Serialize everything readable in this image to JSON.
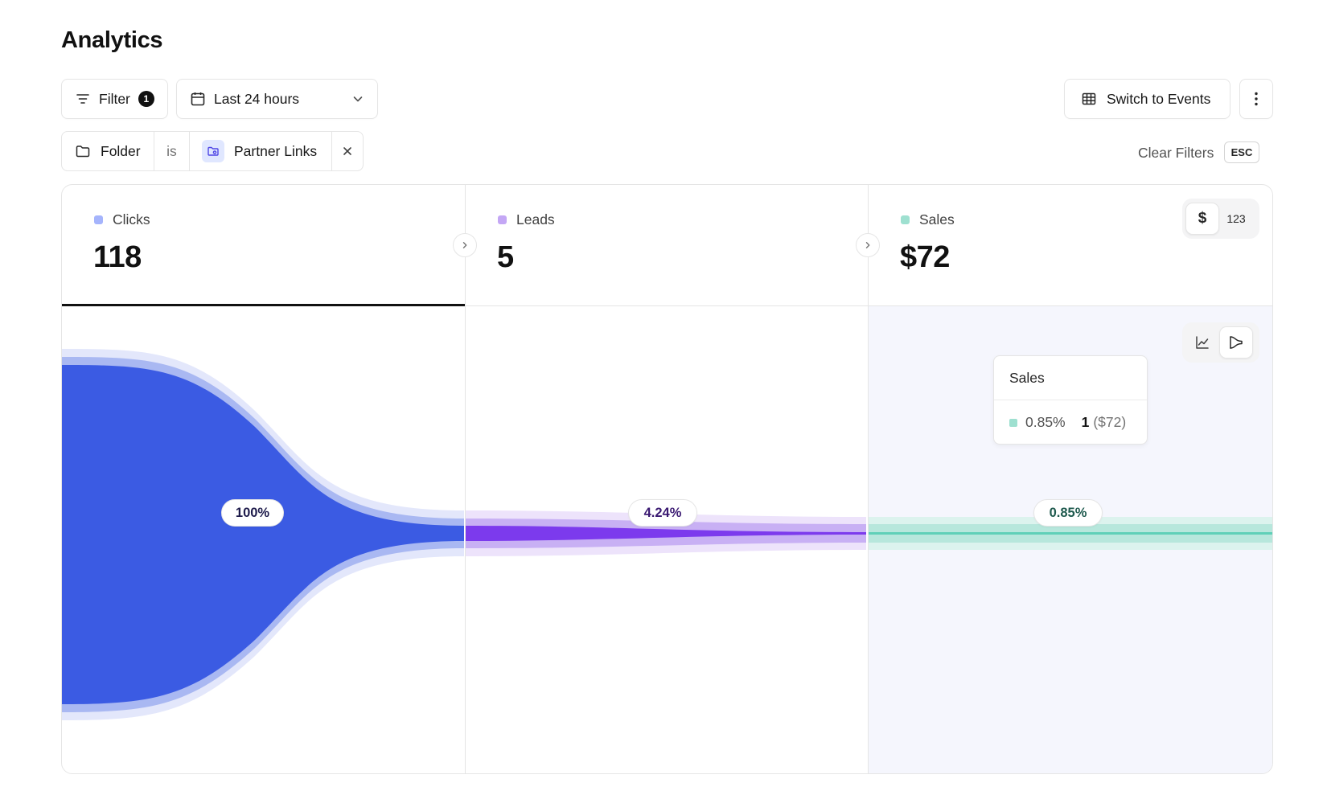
{
  "page": {
    "title": "Analytics"
  },
  "toolbar": {
    "filter_label": "Filter",
    "filter_count": "1",
    "date_range": "Last 24 hours",
    "switch_label": "Switch to Events"
  },
  "active_filter": {
    "field": "Folder",
    "operator": "is",
    "value": "Partner Links"
  },
  "clear_filters": {
    "label": "Clear Filters",
    "shortcut": "ESC"
  },
  "metrics": [
    {
      "label": "Clicks",
      "value": "118",
      "color": "#a5b4fc"
    },
    {
      "label": "Leads",
      "value": "5",
      "color": "#c4a7f5"
    },
    {
      "label": "Sales",
      "value": "$72",
      "color": "#9ee0d0"
    }
  ],
  "unit_toggle": {
    "currency": "$",
    "count": "123"
  },
  "funnel": {
    "steps": [
      {
        "label": "Clicks",
        "percent": "100%",
        "color": "#3b5be3",
        "text_color": "#1e1b4b"
      },
      {
        "label": "Leads",
        "percent": "4.24%",
        "color": "#7c3aed",
        "text_color": "#3b1a72"
      },
      {
        "label": "Sales",
        "percent": "0.85%",
        "color": "#5fd0b8",
        "text_color": "#1f5a4e"
      }
    ]
  },
  "tooltip": {
    "title": "Sales",
    "percent": "0.85%",
    "count": "1",
    "amount": "($72)"
  }
}
